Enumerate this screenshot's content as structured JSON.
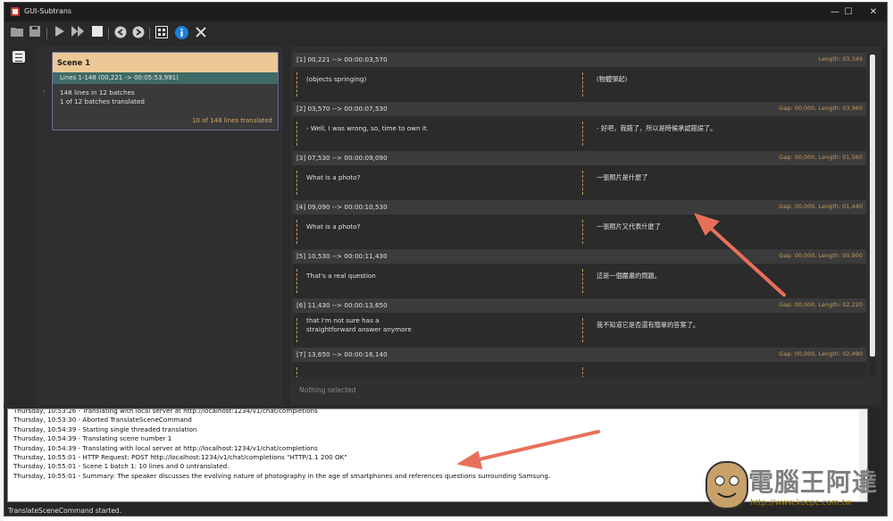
{
  "window": {
    "title": "GUI-Subtrans",
    "controls": [
      "—",
      "☐",
      "✕"
    ]
  },
  "toolbar": {
    "icons": [
      "open-folder-icon",
      "save-icon",
      "play-icon",
      "fast-forward-icon",
      "stop-icon",
      "undo-icon",
      "redo-icon",
      "grid-icon",
      "info-icon",
      "tools-icon"
    ]
  },
  "scene": {
    "title": "Scene 1",
    "lines": "Lines 1-148 (00,221 -> 00:05:53,991)",
    "batches": "148 lines in 12 batches",
    "batches_translated": "1 of 12 batches translated",
    "lines_translated": "10 of 148 lines translated"
  },
  "subtitles": [
    {
      "num": "[1] 00,221 --> 00:00:03,570",
      "gap": "Length: 03,349",
      "orig": "(objects springing)",
      "trans": "(物體彈起)"
    },
    {
      "num": "[2] 03,570 --> 00:00:07,530",
      "gap": "Gap: 00,000, Length: 03,960",
      "orig": "- Well, I was wrong, so, time to own it.",
      "trans": "- 好吧，我錯了，所以是時候承認錯誤了。"
    },
    {
      "num": "[3] 07,530 --> 00:00:09,090",
      "gap": "Gap: 00,000, Length: 01,560",
      "orig": "What is a photo?",
      "trans": "一張照片是什麼了"
    },
    {
      "num": "[4] 09,090 --> 00:00:10,530",
      "gap": "Gap: 00,000, Length: 01,440",
      "orig": "What is a photo?",
      "trans": "一張照片又代表什麼了"
    },
    {
      "num": "[5] 10,530 --> 00:00:11,430",
      "gap": "Gap: 00,000, Length: 00,900",
      "orig": "That's a real question",
      "trans": "這是一個嚴肅的問題。"
    },
    {
      "num": "[6] 11,430 --> 00:00:13,650",
      "gap": "Gap: 00,000, Length: 02,220",
      "orig": "that I'm not sure has a",
      "orig2": "straightforward answer anymore",
      "trans": "我不知道它是否還有簡單的答案了。"
    },
    {
      "num": "[7] 13,650 --> 00:00:16,140",
      "gap": "Gap: 00,000, Length: 02,490",
      "orig": "",
      "trans": ""
    }
  ],
  "selection_status": "Nothing selected",
  "log": [
    "Thursday, 10:53:26 - Translating with local server at http://localhost:1234/v1/chat/completions",
    "Thursday, 10:53:30 - Aborted TranslateSceneCommand",
    "Thursday, 10:54:39 - Starting single threaded translation",
    "Thursday, 10:54:39 - Translating scene number 1",
    "Thursday, 10:54:39 - Translating with local server at http://localhost:1234/v1/chat/completions",
    "Thursday, 10:55:01 - HTTP Request: POST http://localhost:1234/v1/chat/completions \"HTTP/1.1 200 OK\"",
    "Thursday, 10:55:01 - Scene 1 batch 1: 10 lines and 0 untranslated.",
    "Thursday, 10:55:01 - Summary: The speaker discusses the evolving nature of photography in the age of smartphones and references questions surrounding Samsung."
  ],
  "status_bar": "TranslateSceneCommand started.",
  "watermark": {
    "text": "電腦王阿達",
    "url": "http://www.kocpc.com.tw"
  },
  "colors": {
    "accent_gold": "#c89a5b",
    "scene_header": "#ecc896",
    "scene_lines_bar": "#3f6a66",
    "arrow": "#e8705a"
  }
}
